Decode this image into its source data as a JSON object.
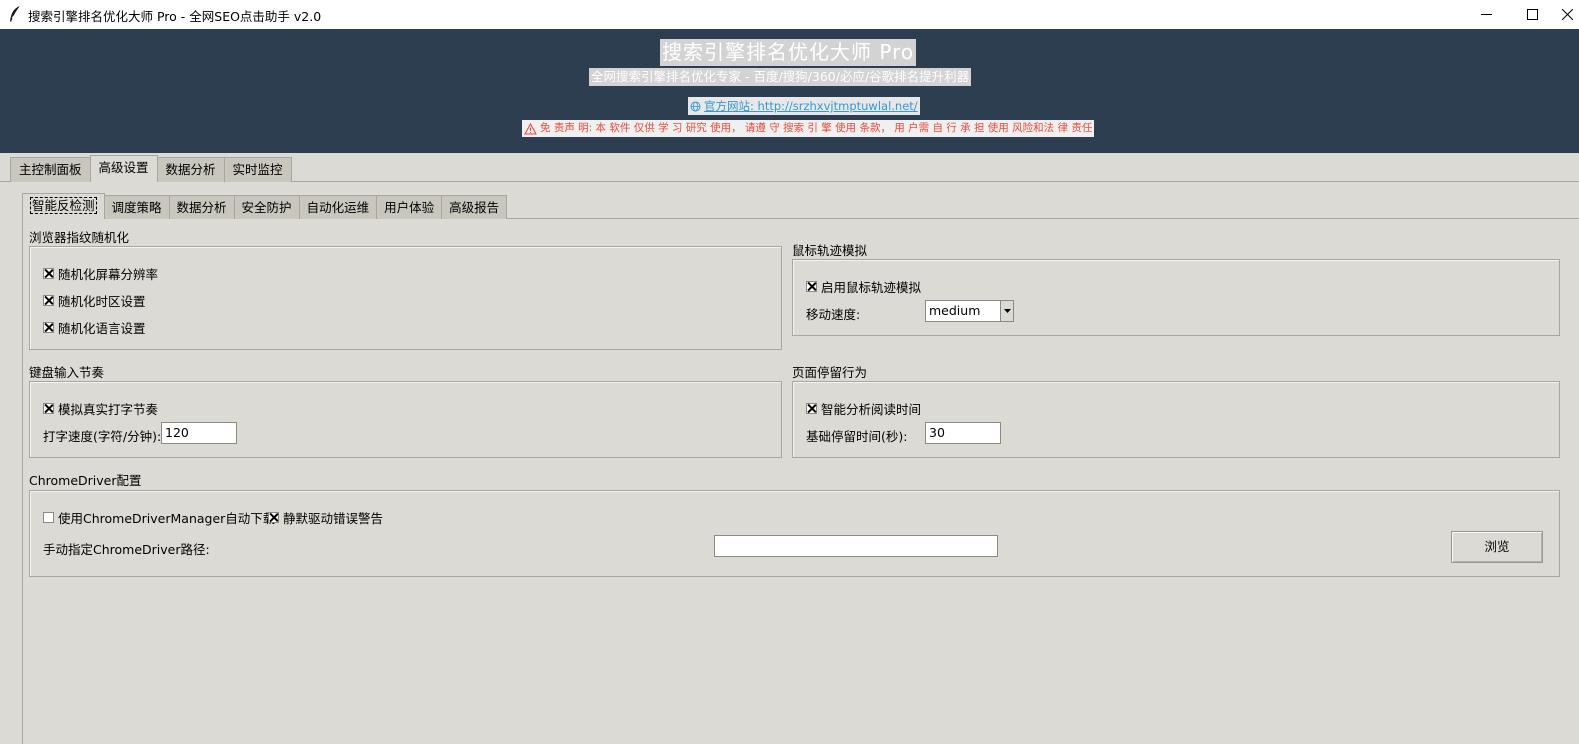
{
  "window": {
    "title": "搜索引擎排名优化大师 Pro - 全网SEO点击助手 v2.0",
    "app_icon": "feather-icon"
  },
  "header": {
    "title": "搜索引擎排名优化大师 Pro",
    "subtitle": "全网搜索引擎排名优化专家 - 百度/搜狗/360/必应/谷歌排名提升利器",
    "website": "官方网站: http://srzhxvjtmptuwlal.net/",
    "disclaimer": "免 责声 明: 本 软件 仅供 学 习 研究 使用， 请遵 守 搜索 引 擎 使用 条款， 用 户需 自 行 承 担 使用 风险和法 律 责任"
  },
  "main_tabs": [
    "主控制面板",
    "高级设置",
    "数据分析",
    "实时监控"
  ],
  "main_tab_active": 1,
  "sub_tabs": [
    "智能反检测",
    "调度策略",
    "数据分析",
    "安全防护",
    "自动化运维",
    "用户体验",
    "高级报告"
  ],
  "sub_tab_active": 0,
  "fingerprint": {
    "label": "浏览器指纹随机化",
    "opt1": "随机化屏幕分辨率",
    "opt2": "随机化时区设置",
    "opt3": "随机化语言设置"
  },
  "mouse": {
    "label": "鼠标轨迹模拟",
    "enable": "启用鼠标轨迹模拟",
    "speed_label": "移动速度:",
    "speed_value": "medium"
  },
  "keyboard": {
    "label": "键盘输入节奏",
    "simulate": "模拟真实打字节奏",
    "speed_label": "打字速度(字符/分钟):",
    "speed_value": "120"
  },
  "dwell": {
    "label": "页面停留行为",
    "smart": "智能分析阅读时间",
    "base_label": "基础停留时间(秒):",
    "base_value": "30"
  },
  "chromedriver": {
    "label": "ChromeDriver配置",
    "use_manager": "使用ChromeDriverManager自动下载",
    "silence": "静默驱动错误警告",
    "path_label": "手动指定ChromeDriver路径:",
    "path_value": "",
    "browse": "浏览"
  },
  "checked": {
    "fp1": true,
    "fp2": true,
    "fp3": true,
    "mouse": true,
    "keyboard": true,
    "dwell": true,
    "use_manager": false,
    "silence": true
  }
}
